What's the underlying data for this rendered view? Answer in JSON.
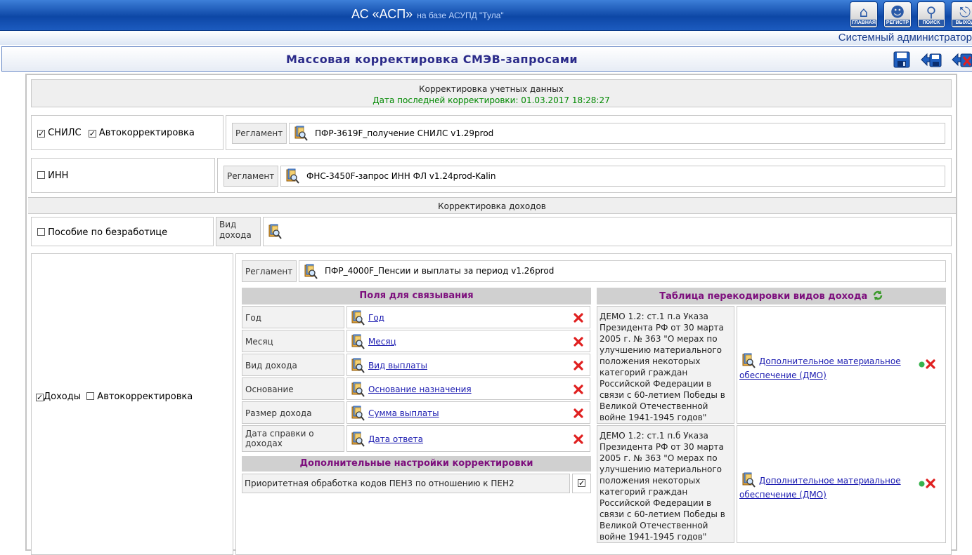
{
  "header": {
    "app_title": "АС «АСП»",
    "app_subtitle": "на базе АСУПД \"Тула\"",
    "buttons": [
      {
        "label": "ГЛАВНАЯ",
        "icon": "home-icon"
      },
      {
        "label": "РЕГИСТР",
        "icon": "people-icon"
      },
      {
        "label": "ПОИСК",
        "icon": "search-icon"
      },
      {
        "label": "ВЫХОД",
        "icon": "exit-icon"
      }
    ],
    "user": "Системный администратор"
  },
  "page": {
    "title": "Массовая корректировка СМЭВ-запросами"
  },
  "accounts": {
    "title": "Корректировка учетных данных",
    "last_date": "Дата последней корректировки: 01.03.2017 18:28:27",
    "snils": {
      "label": "СНИЛС",
      "checked": true,
      "auto_label": "Автокорректировка",
      "auto_checked": true,
      "reg_label": "Регламент",
      "reg_value": "ПФР-3619F_получение СНИЛС v1.29prod"
    },
    "inn": {
      "label": "ИНН",
      "checked": false,
      "reg_label": "Регламент",
      "reg_value": "ФНС-3450F-запрос ИНН ФЛ v1.24prod-Kalin"
    }
  },
  "income": {
    "title": "Корректировка доходов",
    "unemployment": {
      "label": "Пособие по безработице",
      "checked": false,
      "kind_label": "Вид дохода"
    },
    "incomes": {
      "label": "Доходы",
      "checked": true,
      "auto_label": "Автокорректировка",
      "auto_checked": false
    },
    "reg_label": "Регламент",
    "reg_value": "ПФР_4000F_Пенсии и выплаты за период v1.26prod",
    "fields_title": "Поля для связывания",
    "fields": [
      {
        "label": "Год",
        "value": "Год"
      },
      {
        "label": "Месяц",
        "value": "Месяц"
      },
      {
        "label": "Вид дохода",
        "value": "Вид выплаты"
      },
      {
        "label": "Основание",
        "value": "Основание назначения"
      },
      {
        "label": "Размер дохода",
        "value": "Сумма выплаты"
      },
      {
        "label": "Дата справки о доходах",
        "value": "Дата ответа"
      }
    ],
    "settings_title": "Дополнительные настройки корректировки",
    "settings": [
      {
        "label": "Приоритетная обработка кодов ПЕН3 по отношению к ПЕН2",
        "checked": true
      }
    ],
    "recode_title": "Таблица перекодировки видов дохода",
    "recode": [
      {
        "source": "ДЕМО 1.2: ст.1 п.а Указа Президента РФ от 30 марта 2005 г. № 363 \"О мерах по улучшению материального положения некоторых категорий граждан Российской Федерации в связи с 60-летием Победы в Великой Отечественной войне 1941-1945 годов\"",
        "target": "Дополнительное материальное обеспечение (ДМО)"
      },
      {
        "source": "ДЕМО 1.2: ст.1 п.б Указа Президента РФ от 30 марта 2005 г. № 363 \"О мерах по улучшению материального положения некоторых категорий граждан Российской Федерации в связи с 60-летием Победы в Великой Отечественной войне 1941-1945 годов\"",
        "target": "Дополнительное материальное обеспечение (ДМО)"
      }
    ]
  },
  "colors": {
    "accent": "#0d47a6",
    "section_title": "#7d0f7d",
    "date": "#008800",
    "delete": "#e02020"
  }
}
